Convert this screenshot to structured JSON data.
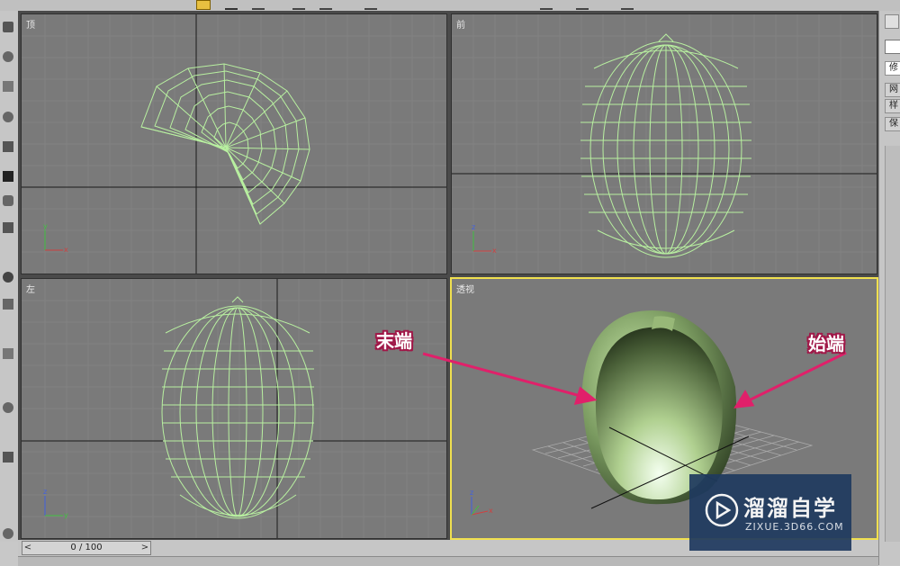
{
  "viewports": {
    "top": {
      "label": "顶"
    },
    "front": {
      "label": "前"
    },
    "left": {
      "label": "左"
    },
    "perspective": {
      "label": "透视"
    }
  },
  "annotations": {
    "end_label": "末端",
    "start_label": "始端",
    "color": "#a01848"
  },
  "command_panel": {
    "tabs": [
      "修改",
      "网",
      "样",
      "保"
    ]
  },
  "time_slider": {
    "frame_display": "0 / 100",
    "prev_label": "<",
    "next_label": ">"
  },
  "watermark": {
    "title": "溜溜自学",
    "url": "ZIXUE.3D66.COM"
  },
  "colors": {
    "viewport_bg": "#7a7a7a",
    "wireframe": "#b8f0a0",
    "active_border": "#f0e050",
    "axis_y": "#40c040",
    "axis_x": "#d04040",
    "axis_z": "#4060e0"
  }
}
